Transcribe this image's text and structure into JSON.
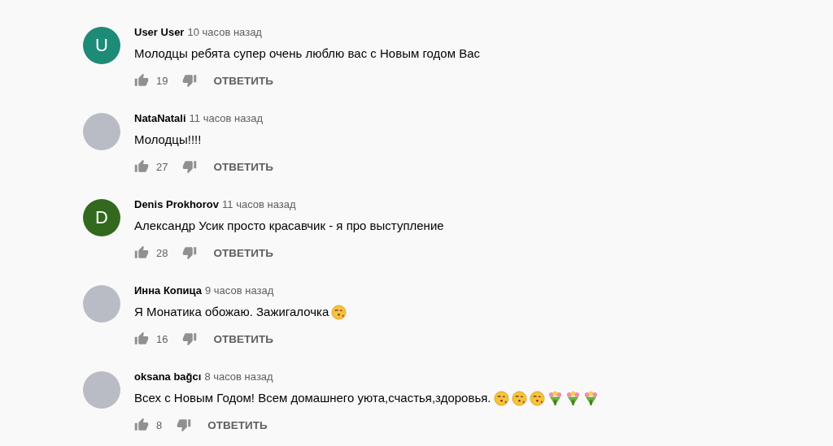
{
  "comments": [
    {
      "author": "User User",
      "time": "10 часов назад",
      "text": "Молодцы ребята супер очень люблю вас с Новым годом Вас",
      "avatar": {
        "kind": "letter",
        "letter": "U",
        "color": "#1e8a78"
      },
      "likes": "19",
      "reply": "ОТВЕТИТЬ"
    },
    {
      "author": "NataNatali",
      "time": "11 часов назад",
      "text": "Молодцы!!!!",
      "avatar": {
        "kind": "photo"
      },
      "likes": "27",
      "reply": "ОТВЕТИТЬ"
    },
    {
      "author": "Denis Prokhorov",
      "time": "11 часов назад",
      "text": "Александр Усик просто красавчик - я про выступление",
      "avatar": {
        "kind": "letter",
        "letter": "D",
        "color": "#33691e"
      },
      "likes": "28",
      "reply": "ОТВЕТИТЬ"
    },
    {
      "author": "Инна Копица",
      "time": "9 часов назад",
      "text": "Я Монатика обожаю. Зажигалочка",
      "emojis": [
        {
          "kind": "kiss"
        }
      ],
      "avatar": {
        "kind": "photo"
      },
      "likes": "16",
      "reply": "ОТВЕТИТЬ"
    },
    {
      "author": "oksana bağcı",
      "time": "8 часов назад",
      "text": "Всех с Новым Годом! Всем домашнего уюта,счастья,здоровья.",
      "emojis": [
        {
          "kind": "kiss"
        },
        {
          "kind": "kiss"
        },
        {
          "kind": "kiss"
        },
        {
          "kind": "bouquet"
        },
        {
          "kind": "bouquet"
        },
        {
          "kind": "bouquet"
        }
      ],
      "avatar": {
        "kind": "photo"
      },
      "likes": "8",
      "reply": "ОТВЕТИТЬ"
    }
  ]
}
